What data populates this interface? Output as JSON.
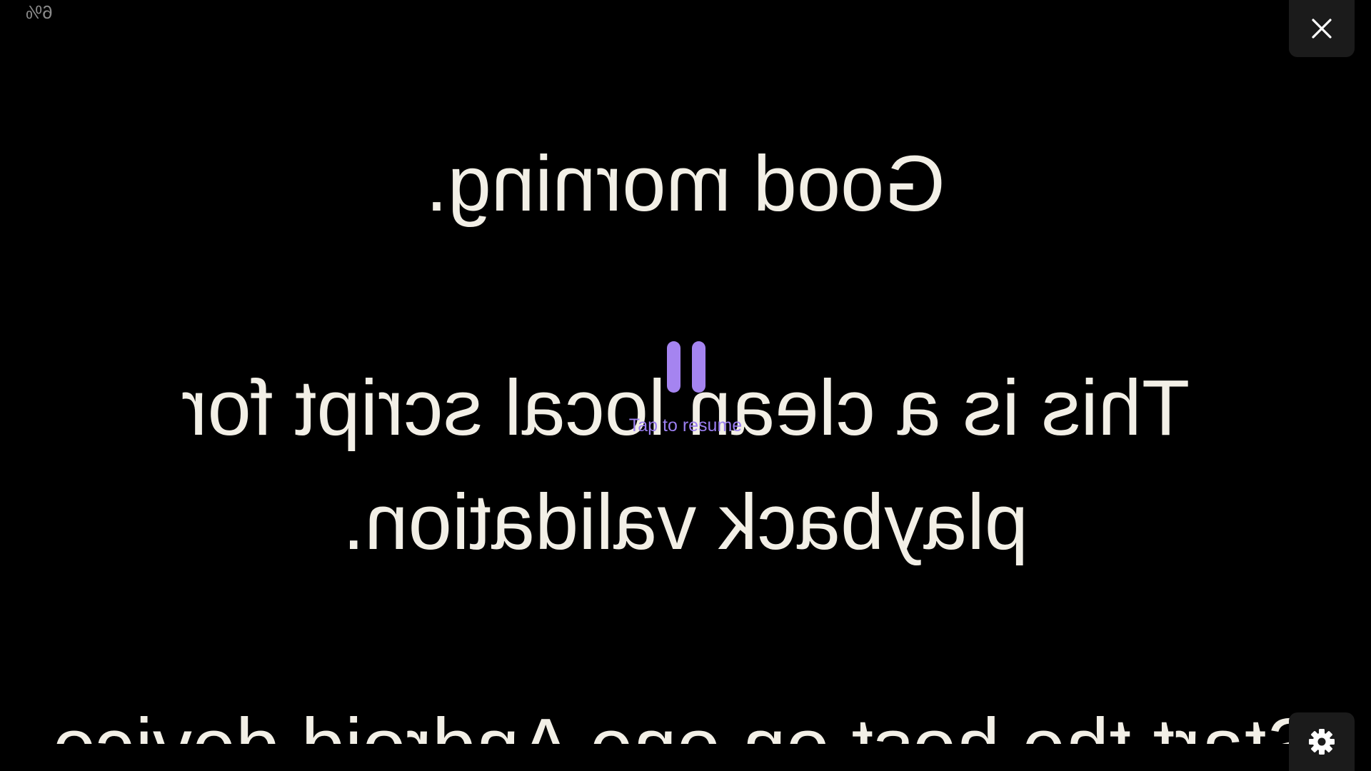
{
  "progress": {
    "percent_text": "6%"
  },
  "script": {
    "lines": [
      "Good morning.",
      "This is a clean local script for",
      "playback validation.",
      "Start the host on one Android device"
    ],
    "mirrored": true,
    "text_color": "#f2efe6",
    "background_color": "#000000"
  },
  "pause_overlay": {
    "resume_label": "Tap to resume",
    "accent_color": "#a584f0",
    "icon": "pause-icon"
  },
  "controls": {
    "close_icon": "close-icon",
    "settings_icon": "gear-icon",
    "button_background": "#1b1b1b"
  }
}
